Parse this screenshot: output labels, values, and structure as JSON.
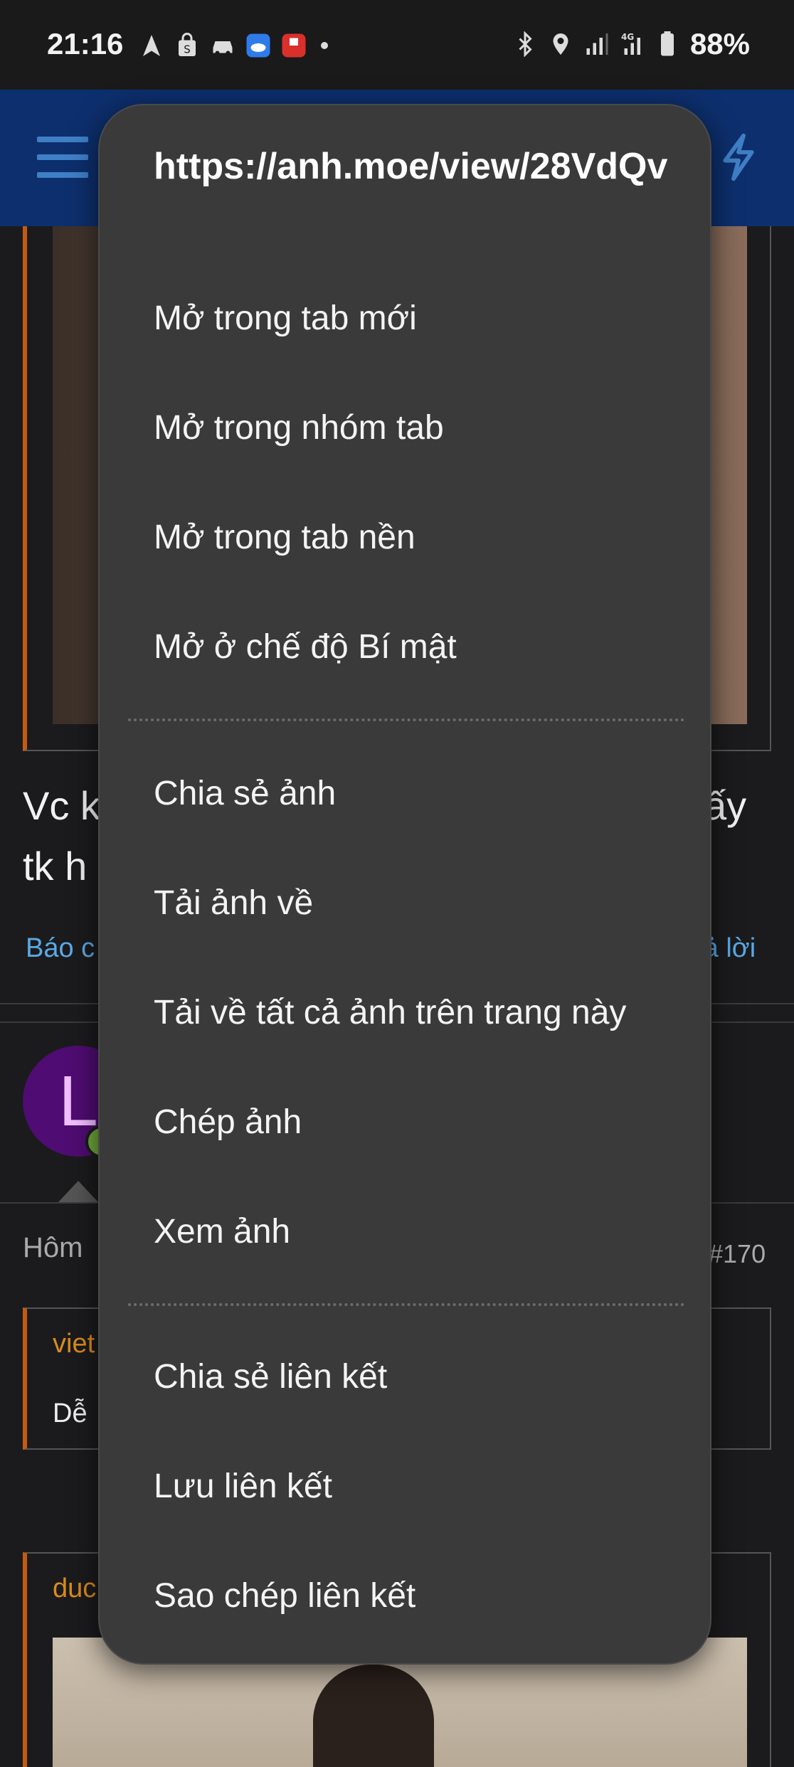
{
  "status_bar": {
    "time": "21:16",
    "battery": "88%",
    "network": "4G",
    "icons_left": [
      "navigation-icon",
      "shopping-bag-icon",
      "car-icon",
      "weather-app-icon",
      "red-app-icon"
    ],
    "icons_right": [
      "bluetooth-icon",
      "location-icon",
      "signal-icon",
      "signal-4g-icon",
      "battery-icon"
    ]
  },
  "background_page": {
    "post_text_left_1": "Vc k",
    "post_text_right_1": "ấy",
    "post_text_left_2": "tk h",
    "report_link": "Báo c",
    "reply_link": "rả lời",
    "avatar_letter": "L",
    "date_left": "Hôm",
    "post_number": "#170",
    "quote1_name": "viet",
    "quote1_text": "Dễ",
    "quote2_name": "duc"
  },
  "context_menu": {
    "url": "https://anh.moe/view/28VdQv",
    "group1": [
      "Mở trong tab mới",
      "Mở trong nhóm tab",
      "Mở trong tab nền",
      "Mở ở chế độ Bí mật"
    ],
    "group2": [
      "Chia sẻ ảnh",
      "Tải ảnh về",
      "Tải về tất cả ảnh trên trang này",
      "Chép ảnh",
      "Xem ảnh"
    ],
    "group3": [
      "Chia sẻ liên kết",
      "Lưu liên kết",
      "Sao chép liên kết"
    ]
  },
  "colors": {
    "header_bg": "#0d2f6d",
    "menu_bg": "#3a3a3b",
    "accent_orange": "#c55a11",
    "link_blue": "#5aa9e6"
  }
}
